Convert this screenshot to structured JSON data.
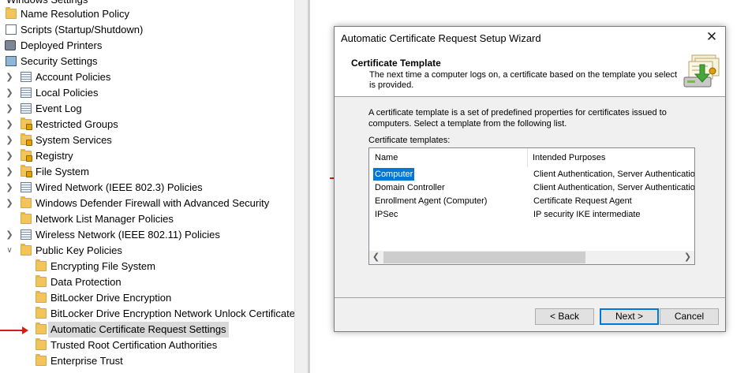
{
  "tree": {
    "items": [
      {
        "label": "Windows Settings",
        "icon": "folder-icon"
      },
      {
        "label": "Name Resolution Policy",
        "icon": "folder-icon"
      },
      {
        "label": "Scripts (Startup/Shutdown)",
        "icon": "script-icon"
      },
      {
        "label": "Deployed Printers",
        "icon": "printer-icon"
      },
      {
        "label": "Security Settings",
        "icon": "security-settings-icon"
      },
      {
        "label": "Account Policies",
        "icon": "policy-doc-icon"
      },
      {
        "label": "Local Policies",
        "icon": "policy-doc-icon"
      },
      {
        "label": "Event Log",
        "icon": "policy-doc-icon"
      },
      {
        "label": "Restricted Groups",
        "icon": "secure-folder-icon"
      },
      {
        "label": "System Services",
        "icon": "secure-folder-icon"
      },
      {
        "label": "Registry",
        "icon": "secure-folder-icon"
      },
      {
        "label": "File System",
        "icon": "secure-folder-icon"
      },
      {
        "label": "Wired Network (IEEE 802.3) Policies",
        "icon": "network-policy-icon"
      },
      {
        "label": "Windows Defender Firewall with Advanced Security",
        "icon": "folder-icon"
      },
      {
        "label": "Network List Manager Policies",
        "icon": "folder-icon"
      },
      {
        "label": "Wireless Network (IEEE 802.11) Policies",
        "icon": "network-policy-icon"
      },
      {
        "label": "Public Key Policies",
        "icon": "folder-icon"
      },
      {
        "label": "Encrypting File System",
        "icon": "folder-icon"
      },
      {
        "label": "Data Protection",
        "icon": "folder-icon"
      },
      {
        "label": "BitLocker Drive Encryption",
        "icon": "folder-icon"
      },
      {
        "label": "BitLocker Drive Encryption Network Unlock Certificate",
        "icon": "folder-icon"
      },
      {
        "label": "Automatic Certificate Request Settings",
        "icon": "folder-icon"
      },
      {
        "label": "Trusted Root Certification Authorities",
        "icon": "folder-icon"
      },
      {
        "label": "Enterprise Trust",
        "icon": "folder-icon"
      }
    ]
  },
  "dialog": {
    "title": "Automatic Certificate Request Setup Wizard",
    "header_title": "Certificate Template",
    "header_subtitle": "The next time a computer logs on, a certificate based on the template you select is provided.",
    "body": "A certificate template is a set of predefined properties for certificates issued to computers. Select a template from the following list.",
    "list_label": "Certificate templates:",
    "columns": [
      "Name",
      "Intended Purposes"
    ],
    "rows": [
      {
        "name": "Computer",
        "purposes": "Client Authentication, Server Authentication",
        "selected": true
      },
      {
        "name": "Domain Controller",
        "purposes": "Client Authentication, Server Authentication"
      },
      {
        "name": "Enrollment Agent (Computer)",
        "purposes": "Certificate Request Agent"
      },
      {
        "name": "IPSec",
        "purposes": "IP security IKE intermediate"
      }
    ],
    "buttons": {
      "back": "< Back",
      "next": "Next >",
      "cancel": "Cancel"
    },
    "close_glyph": "✕"
  },
  "colors": {
    "selection": "#0078d7",
    "arrow": "#d31c1c",
    "folder": "#f2c55c"
  }
}
